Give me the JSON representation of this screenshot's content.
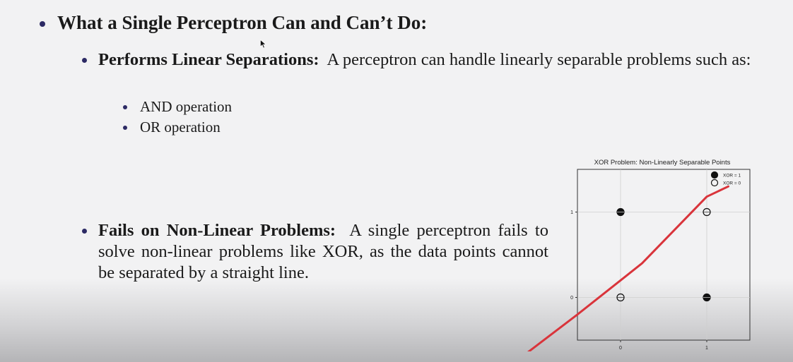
{
  "slide": {
    "heading": "What a Single Perceptron Can and Can’t Do:",
    "linear": {
      "title": "Performs Linear Separations:",
      "text": "A perceptron can handle linearly separable problems such as:"
    },
    "examples": [
      "AND operation",
      "OR operation"
    ],
    "nonlinear": {
      "title": "Fails on Non-Linear Problems:",
      "text": "A single perceptron fails to solve non-linear problems like XOR, as the data points cannot be separated by a straight line."
    }
  },
  "colors": {
    "bullet": "#2c2a64",
    "line": "#d9343b",
    "marker": "#111111"
  },
  "chart_data": {
    "type": "scatter",
    "title": "XOR Problem: Non-Linearly Separable Points",
    "xlabel": "",
    "ylabel": "",
    "xlim": [
      -0.5,
      1.5
    ],
    "ylim": [
      -0.5,
      1.5
    ],
    "xticks": [
      "0",
      "1"
    ],
    "yticks": [
      "0",
      "1"
    ],
    "grid": true,
    "legend": "top-right",
    "series": [
      {
        "name": "XOR = 1",
        "marker": "filled-circle",
        "points": [
          [
            0,
            1
          ],
          [
            1,
            0
          ]
        ]
      },
      {
        "name": "XOR = 0",
        "marker": "open-circle",
        "points": [
          [
            0,
            0
          ],
          [
            1,
            1
          ]
        ]
      }
    ],
    "line": {
      "color": "#d9343b",
      "points": [
        [
          -1.15,
          -0.7
        ],
        [
          -0.5,
          -0.2
        ],
        [
          0.25,
          0.4
        ],
        [
          1.0,
          1.18
        ],
        [
          1.25,
          1.3
        ]
      ]
    }
  }
}
